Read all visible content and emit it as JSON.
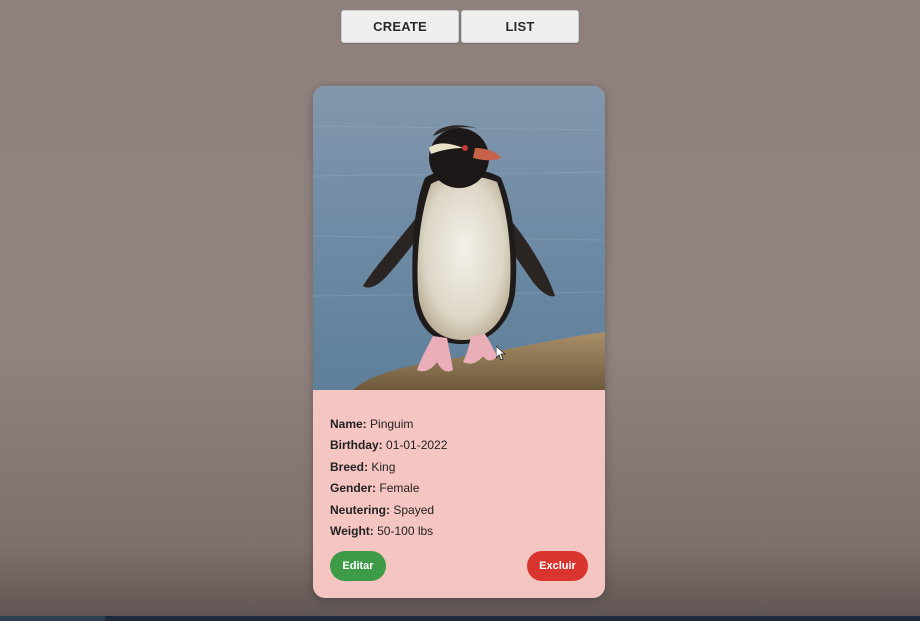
{
  "nav": {
    "create_label": "CREATE",
    "list_label": "LIST"
  },
  "pet": {
    "fields": [
      {
        "label": "Name:",
        "value": "Pinguim"
      },
      {
        "label": "Birthday:",
        "value": "01-01-2022"
      },
      {
        "label": "Breed:",
        "value": "King"
      },
      {
        "label": "Gender:",
        "value": "Female"
      },
      {
        "label": "Neutering:",
        "value": "Spayed"
      },
      {
        "label": "Weight:",
        "value": "50-100 lbs"
      }
    ]
  },
  "actions": {
    "edit_label": "Editar",
    "delete_label": "Excluir"
  },
  "colors": {
    "background": "#918480",
    "card_bg": "#f5c5c2",
    "edit_button": "#3d9b48",
    "delete_button": "#d9342e",
    "nav_button": "#efefef"
  },
  "icons": {
    "cursor": "mouse-pointer-icon"
  }
}
